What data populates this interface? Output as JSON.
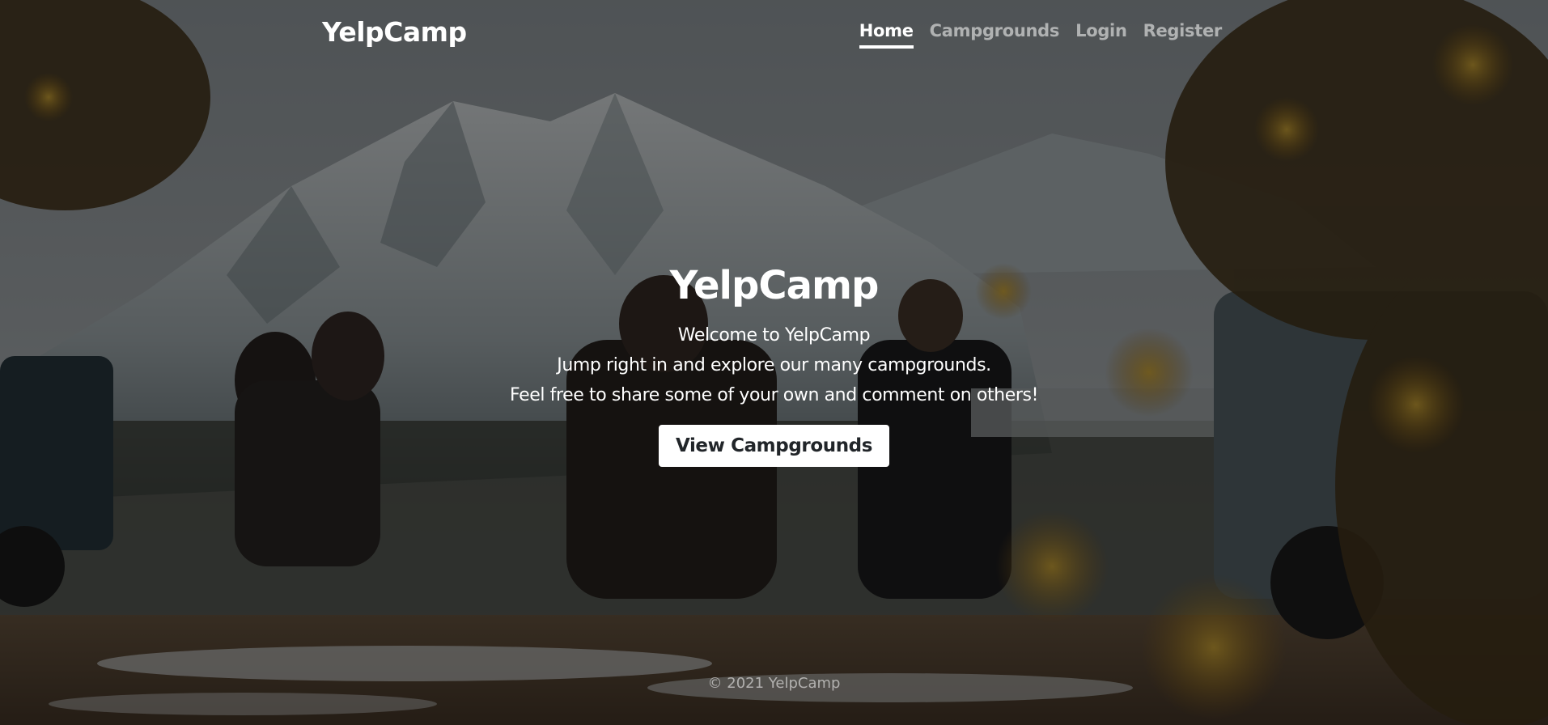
{
  "header": {
    "brand": "YelpCamp",
    "nav": [
      {
        "label": "Home",
        "active": true
      },
      {
        "label": "Campgrounds",
        "active": false
      },
      {
        "label": "Login",
        "active": false
      },
      {
        "label": "Register",
        "active": false
      }
    ]
  },
  "hero": {
    "title": "YelpCamp",
    "lines": [
      "Welcome to YelpCamp",
      "Jump right in and explore our many campgrounds.",
      "Feel free to share some of your own and comment on others!"
    ],
    "button_label": "View Campgrounds"
  },
  "footer": {
    "text": "© 2021 YelpCamp"
  },
  "colors": {
    "text_primary": "#ffffff",
    "text_muted": "#8c8c8c",
    "button_bg": "#ffffff",
    "button_text": "#212529"
  }
}
